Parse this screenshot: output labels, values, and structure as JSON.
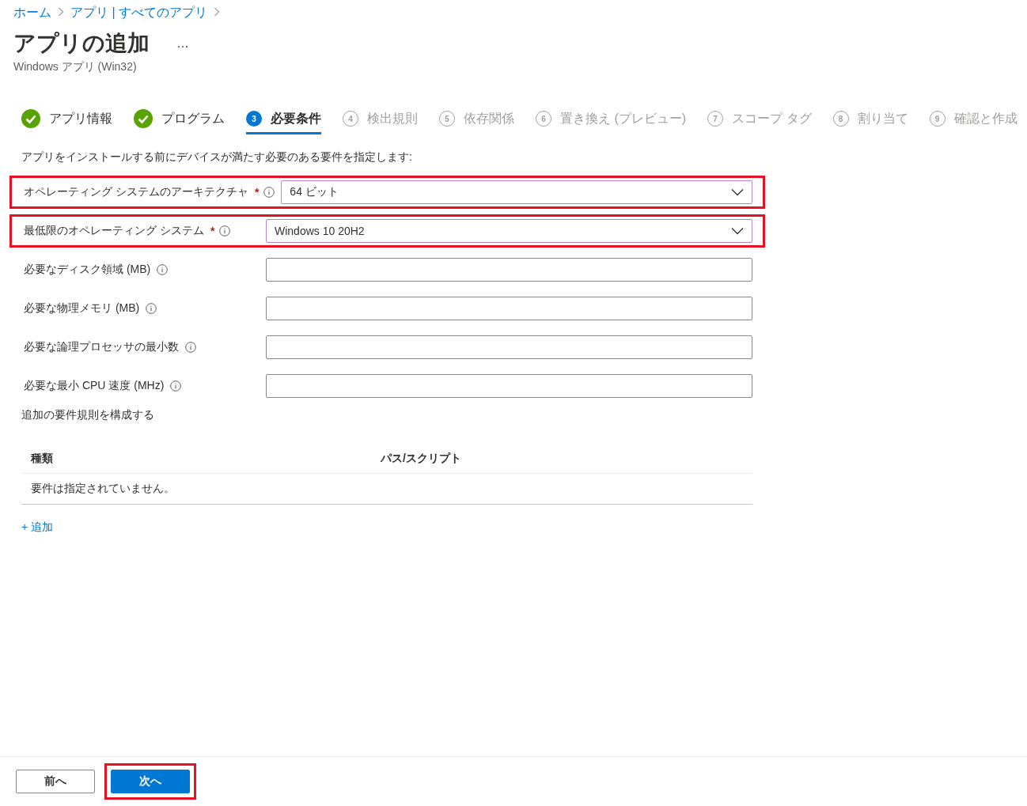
{
  "breadcrumb": [
    {
      "label": "ホーム"
    },
    {
      "label": "アプリ | すべてのアプリ"
    }
  ],
  "header": {
    "title": "アプリの追加",
    "more": "…",
    "subtitle": "Windows アプリ (Win32)"
  },
  "steps": [
    {
      "label": "アプリ情報",
      "completed": true,
      "selected": false
    },
    {
      "label": "プログラム",
      "completed": true,
      "selected": false
    },
    {
      "label": "必要条件",
      "number": "3",
      "completed": false,
      "selected": true
    },
    {
      "label": "検出規則",
      "number": "4",
      "completed": false,
      "selected": false
    },
    {
      "label": "依存関係",
      "number": "5",
      "completed": false,
      "selected": false
    },
    {
      "label": "置き換え (プレビュー)",
      "number": "6",
      "completed": false,
      "selected": false
    },
    {
      "label": "スコープ タグ",
      "number": "7",
      "completed": false,
      "selected": false
    },
    {
      "label": "割り当て",
      "number": "8",
      "completed": false,
      "selected": false
    },
    {
      "label": "確認と作成",
      "number": "9",
      "completed": false,
      "selected": false
    }
  ],
  "description": "アプリをインストールする前にデバイスが満たす必要のある要件を指定します:",
  "fields": [
    {
      "label": "オペレーティング システムのアーキテクチャ",
      "kind": "dropdown",
      "required_mark": "*",
      "highlighted": true,
      "value": "64 ビット"
    },
    {
      "label": "最低限のオペレーティング システム",
      "kind": "dropdown",
      "required_mark": "*",
      "highlighted": true,
      "value": "Windows 10 20H2"
    },
    {
      "label": "必要なディスク領域 (MB)",
      "kind": "text",
      "highlighted": false
    },
    {
      "label": "必要な物理メモリ (MB)",
      "kind": "text",
      "highlighted": false
    },
    {
      "label": "必要な論理プロセッサの最小数",
      "kind": "text",
      "highlighted": false
    },
    {
      "label": "必要な最小 CPU 速度 (MHz)",
      "kind": "text",
      "highlighted": false
    }
  ],
  "rules": {
    "heading": "追加の要件規則を構成する",
    "columns": [
      "種類",
      "パス/スクリプト"
    ],
    "empty_message": "要件は指定されていません。",
    "add_link": "+ 追加"
  },
  "footer": {
    "buttons": [
      {
        "label": "前へ",
        "kind": "secondary",
        "highlighted": false
      },
      {
        "label": "次へ",
        "kind": "primary",
        "highlighted": true
      }
    ]
  }
}
